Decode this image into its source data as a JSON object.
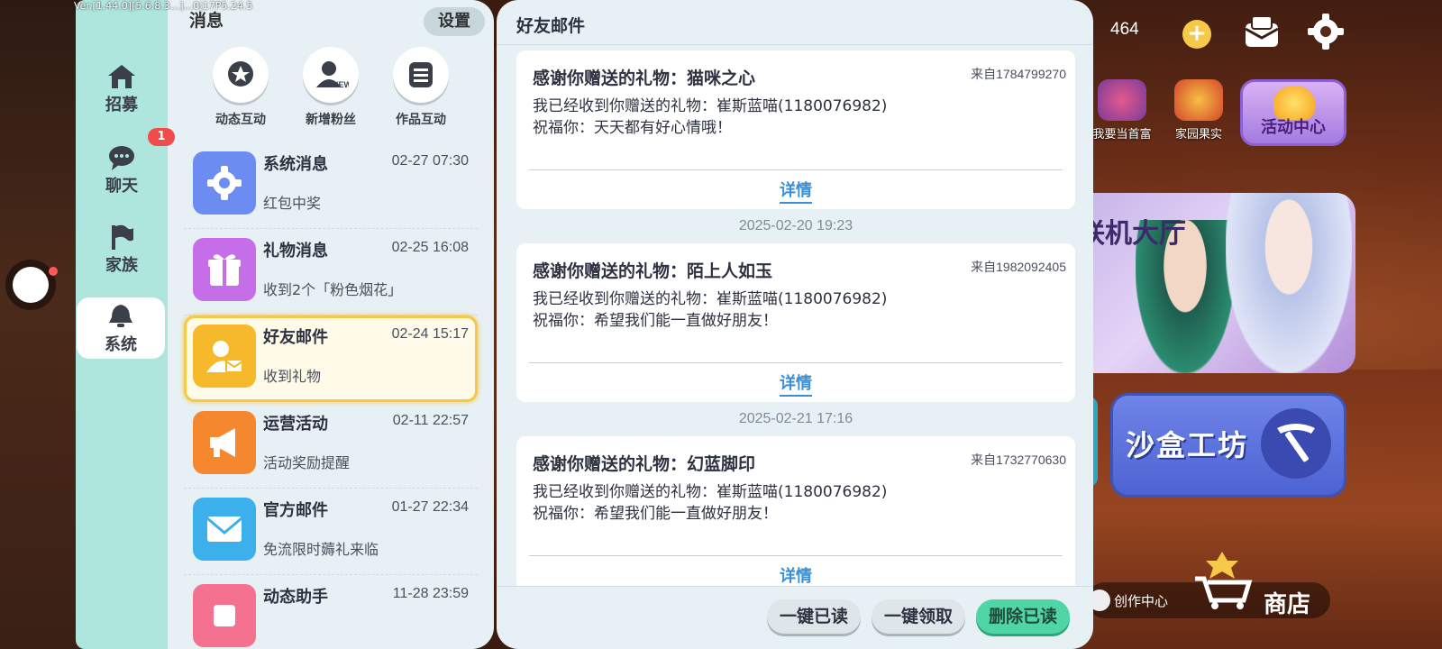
{
  "version_text": "Ver.[1.44.0][5.6.8.3...]...0|17P5.24.5",
  "nav": {
    "items": [
      {
        "label": "招募",
        "icon": "house-icon"
      },
      {
        "label": "聊天",
        "icon": "chat-bubble-icon"
      },
      {
        "label": "家族",
        "icon": "flag-icon"
      },
      {
        "label": "系统",
        "icon": "bell-icon"
      }
    ],
    "chat_badge": "1",
    "active": "系统"
  },
  "messages": {
    "title": "消息",
    "settings_label": "设置",
    "quick_actions": [
      {
        "label": "动态互动",
        "icon": "star-bubble-icon"
      },
      {
        "label": "新增粉丝",
        "icon": "new-fan-icon",
        "tag": "NEW"
      },
      {
        "label": "作品互动",
        "icon": "list-icon"
      }
    ],
    "items": [
      {
        "name": "系统消息",
        "time": "02-27 07:30",
        "preview": "红包中奖",
        "icon": "gear-icon",
        "color": "#6d8cf2"
      },
      {
        "name": "礼物消息",
        "time": "02-25 16:08",
        "preview": "收到2个「粉色烟花」",
        "icon": "gift-icon",
        "color": "#c66de8"
      },
      {
        "name": "好友邮件",
        "time": "02-24 15:17",
        "preview": "收到礼物",
        "icon": "friend-mail-icon",
        "color": "#f6b92b",
        "selected": true
      },
      {
        "name": "运营活动",
        "time": "02-11 22:57",
        "preview": "活动奖励提醒",
        "icon": "megaphone-icon",
        "color": "#f5872f"
      },
      {
        "name": "官方邮件",
        "time": "01-27 22:34",
        "preview": "免流限时薅礼来临",
        "icon": "envelope-icon",
        "color": "#3bb0ea"
      },
      {
        "name": "动态助手",
        "time": "11-28 23:59",
        "preview": "",
        "icon": "assistant-icon",
        "color": "#f4728f"
      }
    ]
  },
  "mail": {
    "title": "好友邮件",
    "cards": [
      {
        "title": "感谢你赠送的礼物：猫咪之心",
        "from": "来自1784799270",
        "body": "我已经收到你赠送的礼物：崔斯蓝喵(1180076982)\n祝福你：天天都有好心情哦！",
        "detail": "详情"
      },
      {
        "date": "2025-02-20 19:23",
        "title": "感谢你赠送的礼物：陌上人如玉",
        "from": "来自1982092405",
        "body": "我已经收到你赠送的礼物：崔斯蓝喵(1180076982)\n祝福你：希望我们能一直做好朋友！",
        "detail": "详情"
      },
      {
        "date": "2025-02-21 17:16",
        "title": "感谢你赠送的礼物：幻蓝脚印",
        "from": "来自1732770630",
        "body": "我已经收到你赠送的礼物：崔斯蓝喵(1180076982)\n祝福你：希望我们能一直做好朋友！",
        "detail": "详情"
      }
    ],
    "buttons": {
      "mark_all_read": "一键已读",
      "claim_all": "一键领取",
      "delete_read": "删除已读"
    }
  },
  "game": {
    "coins": "464",
    "rich_label": "我要当首富",
    "fruit_label": "家园果实",
    "event_label": "活动中心",
    "lobby_label": "联机大厅",
    "sandbox_label": "沙盒工坊",
    "creation_label": "创作中心",
    "shop_label": "商店"
  }
}
